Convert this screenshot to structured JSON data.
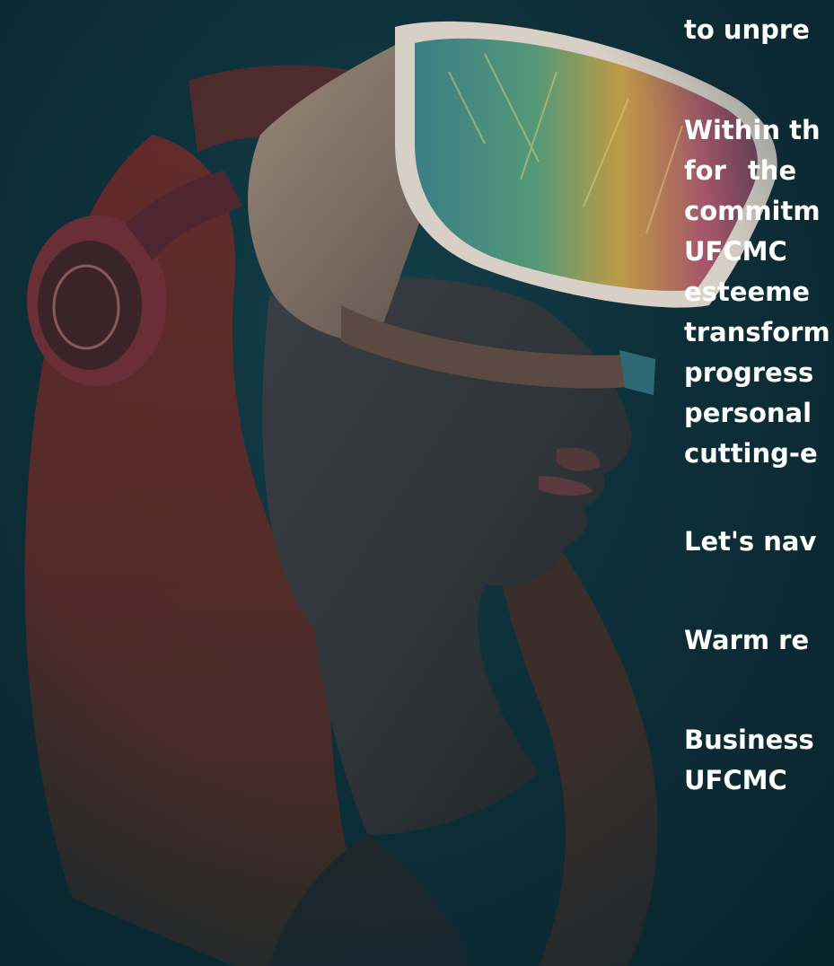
{
  "article": {
    "p1_line1": "to unpre",
    "p2_line1": "Within th",
    "p2_line2": "for  the",
    "p2_line3": "commitm",
    "p2_line4": "UFCMC",
    "p2_line5": "esteeme",
    "p2_line6": "transform",
    "p2_line7": "progress",
    "p2_line8": "personal",
    "p2_line9": "cutting-e",
    "p3_line1": "Let's nav",
    "closing": "Warm re",
    "signature_line1": "Business",
    "signature_line2": "UFCMC"
  },
  "colors": {
    "background": "#0b2a33",
    "text": "#ffffff",
    "hair": "#7a2f2a",
    "headset": "#c9b8a8",
    "visor_strap": "#2e6a76"
  }
}
